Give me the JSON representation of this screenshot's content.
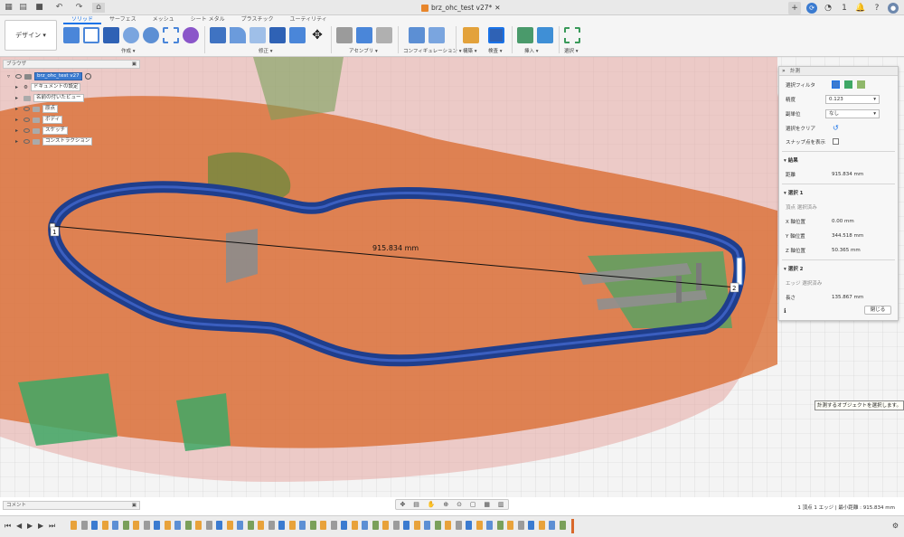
{
  "window": {
    "doc_title": "brz_ohc_test v27*",
    "avatar_label": "1"
  },
  "toolbar": {
    "workspace": "デザイン ▾",
    "tabs": [
      "ソリッド",
      "サーフェス",
      "メッシュ",
      "シート メタル",
      "プラスチック",
      "ユーティリティ"
    ],
    "groups": [
      "作成 ▾",
      "修正 ▾",
      "アセンブリ ▾",
      "コンフィギュレーション ▾",
      "構築 ▾",
      "検査 ▾",
      "挿入 ▾",
      "選択 ▾"
    ]
  },
  "browser": {
    "title": "ブラウザ",
    "root": "brz_ohc_test v27",
    "items": [
      "ドキュメントの設定",
      "名前の付いたビュー",
      "原点",
      "ボディ",
      "スケッチ",
      "コンストラクション"
    ]
  },
  "measure": {
    "title": "計測",
    "filter_label": "選択フィルタ",
    "precision_label": "精度",
    "precision_value": "0.123",
    "units_label": "副単位",
    "units_value": "なし",
    "clear_label": "選択をクリア",
    "snap_label": "スナップ点を表示",
    "result_header": "結果",
    "distance_label": "距離",
    "distance_value": "915.834 mm",
    "sel1_header": "選択 1",
    "sel1_desc": "頂点 選択済み",
    "x_label": "X 軸位置",
    "x_value": "0.00 mm",
    "y_label": "Y 軸位置",
    "y_value": "344.518 mm",
    "z_label": "Z 軸位置",
    "z_value": "50.365 mm",
    "sel2_header": "選択 2",
    "sel2_desc": "エッジ 選択済み",
    "length_label": "長さ",
    "length_value": "135.867 mm",
    "close_label": "閉じる"
  },
  "viewport": {
    "dimension_label": "915.834 mm",
    "point1": "1",
    "point2": "2",
    "tooltip": "計測するオブジェクトを選択します。"
  },
  "bottom": {
    "comments": "コメント",
    "status": "1 頂点 1 エッジ | 最小距離 : 915.834 mm"
  },
  "colors": {
    "accent": "#1a73e8",
    "band": "#1f3e8c",
    "orange": "#d9682b",
    "green": "#3fa865"
  }
}
